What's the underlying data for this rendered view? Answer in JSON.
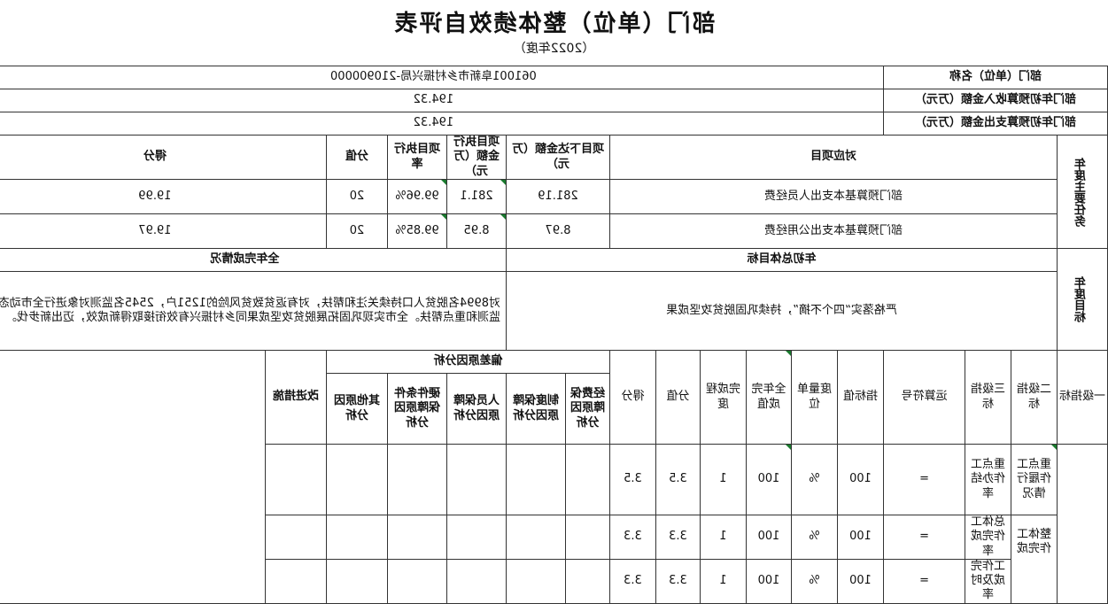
{
  "title": "部门（单位）整体绩效自评表",
  "subtitle": "（2022年度）",
  "dept": {
    "name_label": "部门（单位）名称",
    "name_value": "061001阜新市乡村振兴局-210900000",
    "income_label": "部门年初预算收入金额（万元）",
    "income_value": "194.32",
    "expense_label": "部门年初预算支出金额（万元）",
    "expense_value": "194.32"
  },
  "tasks": {
    "section_label": "年度主要任务",
    "headers": [
      "对应项目",
      "项目下达金额（万元）",
      "项目执行金额（万元）",
      "项目执行率",
      "分值",
      "得分"
    ],
    "rows": [
      [
        "部门预算基本支出人员经费",
        "281.19",
        "281.1",
        "99.96%",
        "20",
        "19.99"
      ],
      [
        "部门预算基本支出公用经费",
        "8.97",
        "8.95",
        "99.85%",
        "20",
        "19.97"
      ]
    ]
  },
  "goals": {
    "section_label": "年度目标",
    "target_header": "年初总体目标",
    "done_header": "全年完成情况",
    "target_text": "严格落实“四个不摘”，持续巩固脱贫攻坚成果",
    "done_text": "对8994名脱贫人口持续关注和帮扶，对有返贫致贫风险的1251户，2545名监测对象进行全市动态监测和重点帮扶。全市实现巩固拓展脱贫攻坚成果同乡村振兴有效衔接取得新成效，迈出新步伐。"
  },
  "indicators": {
    "headers": {
      "level1": "一级指标",
      "level2": "二级指标",
      "level3": "三级指标",
      "op": "运算符号",
      "target": "指标值",
      "unit": "度量单位",
      "actual": "全年完成值",
      "degree": "完成程度",
      "weight": "分值",
      "score": "得分",
      "deviation": "偏差原因分析",
      "dev_cols": [
        "经费保障原因分析",
        "制度保障原因分析",
        "人员保障原因分析",
        "硬件条件保障原因分析",
        "其他原因分析"
      ],
      "measures": "改进措施"
    },
    "level2_a": "重点工作履行情况",
    "level2_b": "整体工作完成",
    "rows": [
      {
        "name": "重点工作办结率",
        "op": "=",
        "target": "100",
        "unit": "%",
        "actual": "100",
        "degree": "1",
        "weight": "3.5",
        "score": "3.5"
      },
      {
        "name": "总体工作完成率",
        "op": "=",
        "target": "100",
        "unit": "%",
        "actual": "100",
        "degree": "1",
        "weight": "3.3",
        "score": "3.3"
      },
      {
        "name": "工作完成及时率",
        "op": "=",
        "target": "100",
        "unit": "%",
        "actual": "100",
        "degree": "1",
        "weight": "3.3",
        "score": "3.3"
      }
    ]
  }
}
